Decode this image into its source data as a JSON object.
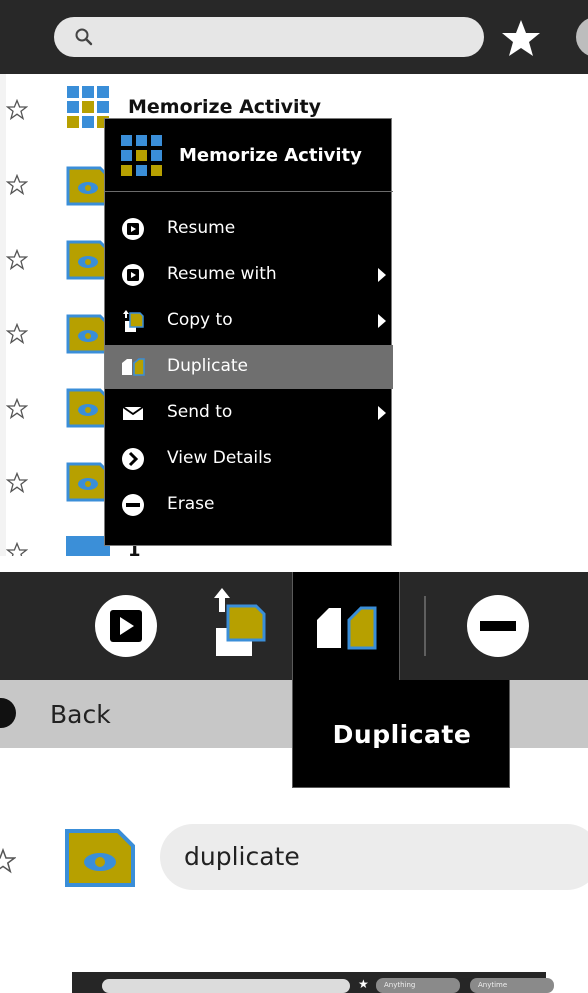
{
  "top": {
    "list": {
      "first_title": "Memorize Activity",
      "partial_row_text": "1"
    },
    "context_menu": {
      "title": "Memorize Activity",
      "items": [
        {
          "label": "Resume",
          "icon": "resume-icon",
          "submenu": false
        },
        {
          "label": "Resume with",
          "icon": "resume-with-icon",
          "submenu": true
        },
        {
          "label": "Copy to",
          "icon": "copy-to-icon",
          "submenu": true
        },
        {
          "label": "Duplicate",
          "icon": "duplicate-icon",
          "submenu": false,
          "highlighted": true
        },
        {
          "label": "Send to",
          "icon": "send-icon",
          "submenu": true
        },
        {
          "label": "View Details",
          "icon": "view-details-icon",
          "submenu": false
        },
        {
          "label": "Erase",
          "icon": "erase-icon",
          "submenu": false
        }
      ]
    }
  },
  "bottom": {
    "back_label": "Back",
    "tooltip": "Duplicate",
    "entry_title_value": "duplicate",
    "thumbnail": {
      "filter_1": "Anything",
      "filter_2": "Anytime"
    }
  },
  "colors": {
    "toolbar": "#282828",
    "menu_bg": "#000000",
    "menu_highlight": "#6f6f6f",
    "activity_blue": "#3a8ed8",
    "journal_olive": "#b7a000"
  }
}
